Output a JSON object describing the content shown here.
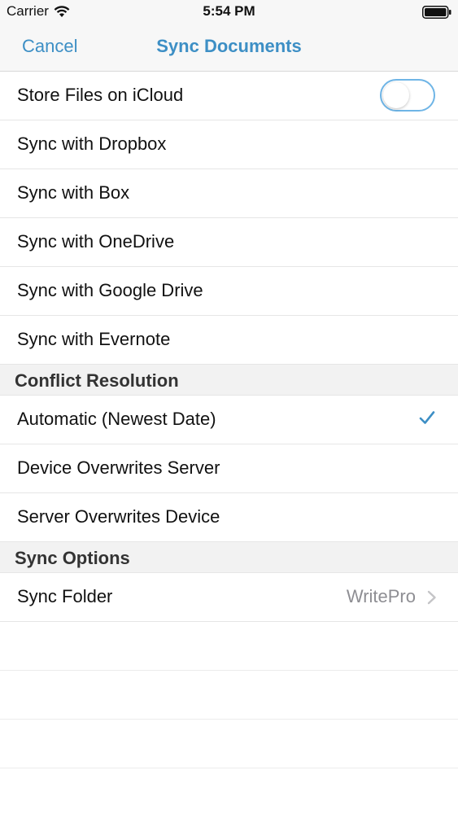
{
  "status_bar": {
    "carrier": "Carrier",
    "time": "5:54 PM",
    "icons": [
      "wifi-icon",
      "battery-icon"
    ]
  },
  "nav": {
    "cancel_label": "Cancel",
    "title": "Sync Documents"
  },
  "accent_color": "#3d8fc5",
  "storage": {
    "icloud": {
      "label": "Store Files on iCloud",
      "toggle_on": false
    },
    "services": [
      {
        "label": "Sync with Dropbox"
      },
      {
        "label": "Sync with Box"
      },
      {
        "label": "Sync with OneDrive"
      },
      {
        "label": "Sync with Google Drive"
      },
      {
        "label": "Sync with Evernote"
      }
    ]
  },
  "conflict": {
    "header": "Conflict Resolution",
    "options": [
      {
        "label": "Automatic (Newest Date)",
        "selected": true
      },
      {
        "label": "Device Overwrites Server",
        "selected": false
      },
      {
        "label": "Server Overwrites Device",
        "selected": false
      }
    ]
  },
  "sync_options": {
    "header": "Sync Options",
    "folder": {
      "label": "Sync Folder",
      "value": "WritePro"
    }
  }
}
